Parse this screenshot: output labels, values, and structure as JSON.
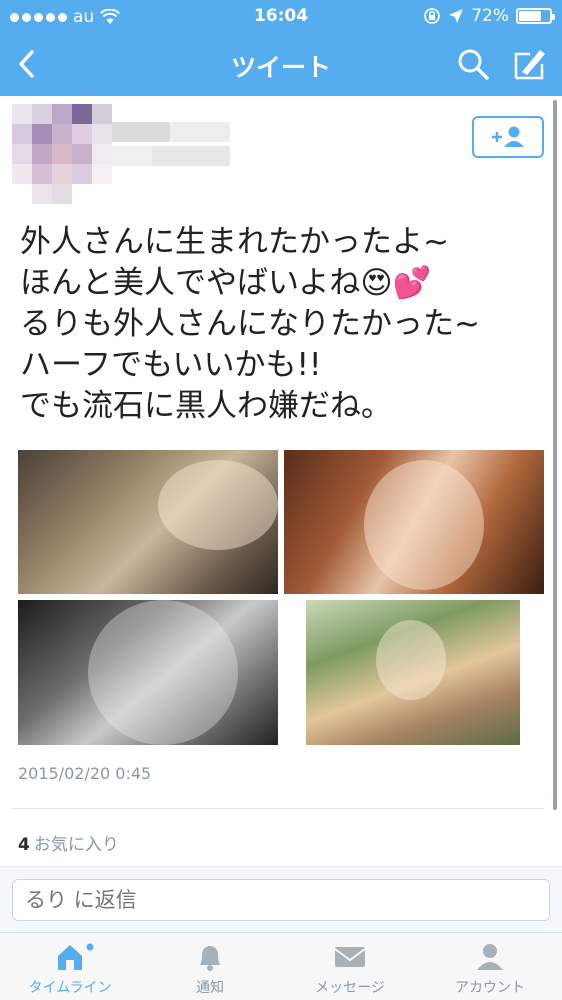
{
  "status_bar": {
    "carrier": "au",
    "time": "16:04",
    "battery": "72%",
    "battery_level": 0.72
  },
  "nav": {
    "title": "ツイート",
    "back_icon": "chevron-left-icon",
    "search_icon": "search-icon",
    "compose_icon": "compose-icon"
  },
  "tweet": {
    "lines": [
      "外人さんに生まれたかったよ~",
      "ほんと美人でやばいよね😍💕",
      "るりも外人さんになりたかった~",
      "ハーフでもいいかも!!",
      "でも流石に黒人わ嫌だね。"
    ],
    "timestamp": "2015/02/20 0:45",
    "favorites_count": "4",
    "favorites_label": "お気に入り"
  },
  "reply": {
    "placeholder": "るり に返信"
  },
  "tabbar": {
    "items": [
      {
        "label": "タイムライン",
        "icon": "home-icon",
        "active": true
      },
      {
        "label": "通知",
        "icon": "bell-icon",
        "active": false
      },
      {
        "label": "メッセージ",
        "icon": "envelope-icon",
        "active": false
      },
      {
        "label": "アカウント",
        "icon": "person-icon",
        "active": false
      }
    ]
  },
  "colors": {
    "brand": "#55acee",
    "muted": "#8899a6"
  }
}
